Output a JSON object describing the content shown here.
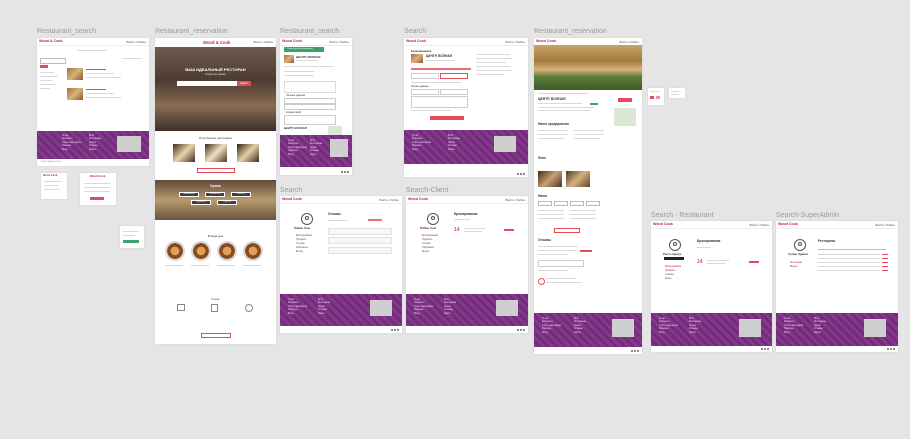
{
  "app": {
    "brand": "Wood & Cook",
    "brand_short": "Wood Cook"
  },
  "labels": {
    "f1": "Restaurant_search",
    "f2": "Restaurant_reservation",
    "f3": "Restaurant_search",
    "f4": "Search",
    "f5": "Restaurant_reservation",
    "f6": "Search",
    "f7": "Search-Client",
    "f8": "Search - Restaurant",
    "f9": "Search-SuperAdmin"
  },
  "frames": {
    "hero_title": "ВАШ ИДЕАЛЬНЫЙ РЕСТОРАН",
    "hero_sub": "Строго по списку",
    "search_btn": "Найти",
    "popular_title": "Популярные рестораны",
    "kitchen_title": "Кухни",
    "kitchen_chips": [
      "Европейская",
      "Итальянская",
      "Японская",
      "Грузинская",
      "Русская"
    ],
    "dishes_title": "Блюда дня",
    "about_title": "О нас",
    "more_btn": "Смотреть все",
    "rest_name": "ЦЕНТР, ВОЛНАЯ",
    "rest_name2": "ЦЕНТР, ВОЛНАЯ",
    "booking_btn": "Забронировать",
    "menu_title": "Меню предприятия",
    "photo_title": "Фото",
    "reviews_title": "Отзывы",
    "menu_sub": "Меню",
    "orders_title": "Отзывы",
    "reservations_title": "Бронирования",
    "restaurants_title": "Рестораны",
    "user_name": "Рабин Сем",
    "user_name2": "Рабин Сем",
    "rest_user": "Ресто Центр",
    "admin_user": "Супер Админ",
    "side_links": [
      "Бронирования",
      "Профиль",
      "Отзывы",
      "Избранное",
      "Выход"
    ],
    "side_links_rest": [
      "Бронирования",
      "Профиль",
      "Отзывы",
      "Меню"
    ],
    "side_links_admin": [
      "Рестораны",
      "Выход"
    ],
    "date_num": "14",
    "header_user": "Войти / Рабин",
    "footer_links": [
      "О нас",
      "Контакты",
      "Стать партнером",
      "Помощь",
      "Вход"
    ],
    "footer_links2": [
      "Блог",
      "Рестораны",
      "Акции",
      "Отзывы",
      "Карта"
    ],
    "copyright": "© 2019 Wood & Cook",
    "city": "Минск",
    "booking_title": "Бронирование",
    "booking_success": "Столик успешно забронирован",
    "private_title": "Личные данные",
    "comment_title": "Комментарий",
    "address": "ул. Волная, 12"
  }
}
